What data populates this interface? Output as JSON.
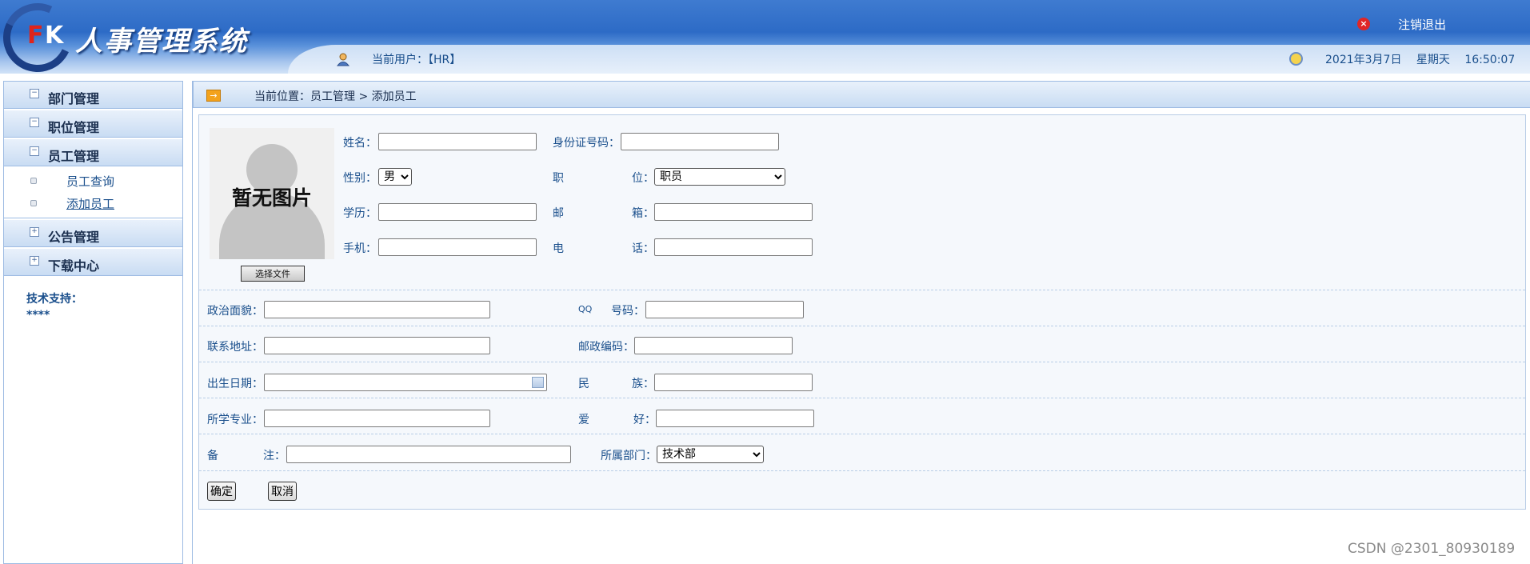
{
  "header": {
    "logo_f": "F",
    "logo_k": "K",
    "title": "人事管理系统",
    "current_user": "当前用户：【HR】",
    "logout": "注销退出",
    "logout_icon": "×",
    "date": "2021年3月7日",
    "weekday": "星期天",
    "time": "16:50:07"
  },
  "sidebar": {
    "menus": [
      {
        "label": "部门管理",
        "icon": "−"
      },
      {
        "label": "职位管理",
        "icon": "−"
      },
      {
        "label": "员工管理",
        "icon": "−"
      },
      {
        "label": "公告管理",
        "icon": "+"
      },
      {
        "label": "下载中心",
        "icon": "+"
      }
    ],
    "sub_items": [
      {
        "label": "员工查询"
      },
      {
        "label": "添加员工"
      }
    ],
    "support_title": "技术支持：",
    "support_value": "****"
  },
  "breadcrumb": {
    "icon": "→",
    "text": "当前位置：员工管理 > 添加员工"
  },
  "form": {
    "photo_text": "暂无图片",
    "file_button": "选择文件",
    "name_label": "姓名：",
    "idcard_label": "身份证号码：",
    "gender_label": "性别：",
    "gender_value": "男",
    "position_label_a": "职",
    "position_label_b": "位：",
    "position_value": "职员",
    "education_label": "学历：",
    "email_label_a": "邮",
    "email_label_b": "箱：",
    "mobile_label": "手机：",
    "phone_label_a": "电",
    "phone_label_b": "话：",
    "party_label": "政治面貌：",
    "qq_label_a": "QQ",
    "qq_label_b": "号码：",
    "address_label": "联系地址：",
    "postcode_label": "邮政编码：",
    "birthday_label": "出生日期：",
    "nation_label_a": "民",
    "nation_label_b": "族：",
    "major_label": "所学专业：",
    "hobby_label_a": "爱",
    "hobby_label_b": "好：",
    "remark_label_a": "备",
    "remark_label_b": "注：",
    "dept_label": "所属部门：",
    "dept_value": "技术部",
    "confirm": "确定",
    "cancel": "取消"
  },
  "watermark": "CSDN @2301_80930189"
}
